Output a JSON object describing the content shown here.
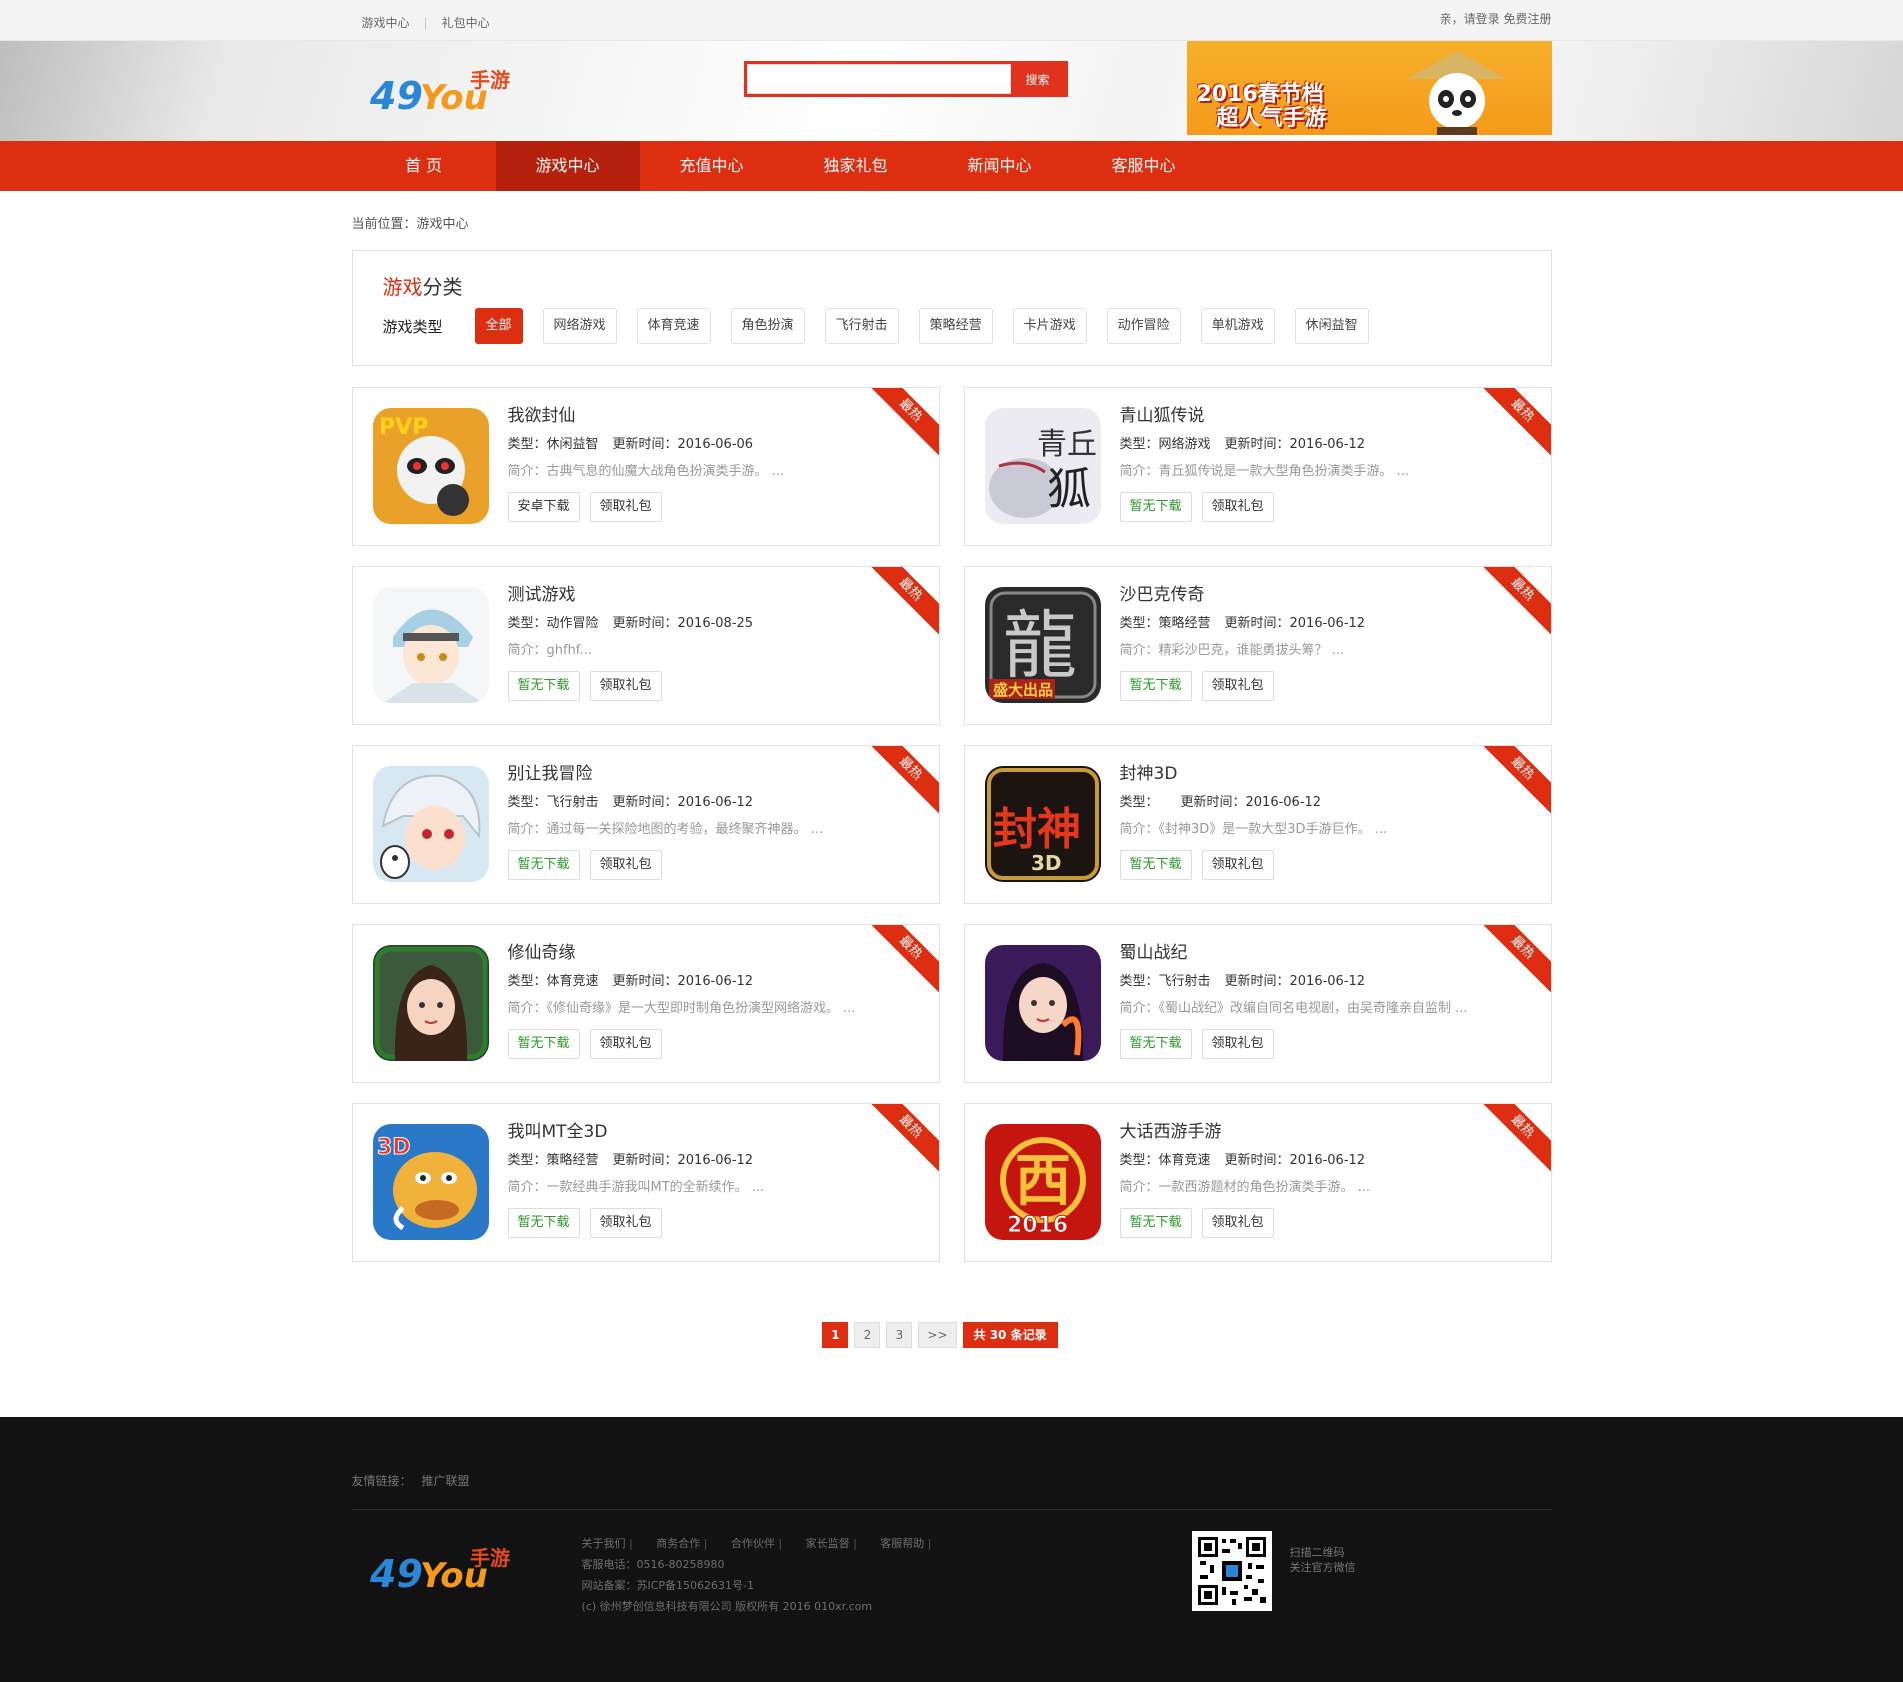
{
  "top": {
    "links": [
      "游戏中心",
      "礼包中心"
    ],
    "greeting": "亲，请登录",
    "register": "免费注册"
  },
  "header": {
    "logo_text": "49You手游",
    "search_button": "搜索",
    "search_value": "",
    "banner_line1": "2016春节档",
    "banner_line2": "超人气手游"
  },
  "nav": [
    "首 页",
    "游戏中心",
    "充值中心",
    "独家礼包",
    "新闻中心",
    "客服中心"
  ],
  "breadcrumb": "当前位置：游戏中心",
  "category": {
    "title_red": "游戏",
    "title_rest": "分类",
    "label": "游戏类型",
    "types": [
      "全部",
      "网络游戏",
      "体育竞速",
      "角色扮演",
      "飞行射击",
      "策略经营",
      "卡片游戏",
      "动作冒险",
      "单机游戏",
      "休闲益智"
    ]
  },
  "games": [
    {
      "name": "我欲封仙",
      "type": "类型：休闲益智",
      "updated": "更新时间：2016-06-06",
      "desc": "简介：古典气息的仙魔大战角色扮演类手游。 ...",
      "download": "安卓下载",
      "gift": "领取礼包",
      "badge": "最热"
    },
    {
      "name": "青山狐传说",
      "type": "类型：网络游戏",
      "updated": "更新时间：2016-06-12",
      "desc": "简介：青丘狐传说是一款大型角色扮演类手游。 ...",
      "download": "暂无下载",
      "gift": "领取礼包",
      "badge": "最热"
    },
    {
      "name": "测试游戏",
      "type": "类型：动作冒险",
      "updated": "更新时间：2016-08-25",
      "desc": "简介：ghfhf...",
      "download": "暂无下载",
      "gift": "领取礼包",
      "badge": "最热"
    },
    {
      "name": "沙巴克传奇",
      "type": "类型：策略经营",
      "updated": "更新时间：2016-06-12",
      "desc": "简介：精彩沙巴克，谁能勇拔头筹？ ...",
      "download": "暂无下载",
      "gift": "领取礼包",
      "badge": "最热"
    },
    {
      "name": "别让我冒险",
      "type": "类型：飞行射击",
      "updated": "更新时间：2016-06-12",
      "desc": "简介：通过每一关探险地图的考验，最终聚齐神器。 ...",
      "download": "暂无下载",
      "gift": "领取礼包",
      "badge": "最热"
    },
    {
      "name": "封神3D",
      "type": "类型：",
      "updated": "更新时间：2016-06-12",
      "desc": "简介：《封神3D》是一款大型3D手游巨作。 ...",
      "download": "暂无下载",
      "gift": "领取礼包",
      "badge": "最热"
    },
    {
      "name": "修仙奇缘",
      "type": "类型：体育竞速",
      "updated": "更新时间：2016-06-12",
      "desc": "简介：《修仙奇缘》是一大型即时制角色扮演型网络游戏。 ...",
      "download": "暂无下载",
      "gift": "领取礼包",
      "badge": "最热"
    },
    {
      "name": "蜀山战纪",
      "type": "类型：飞行射击",
      "updated": "更新时间：2016-06-12",
      "desc": "简介：《蜀山战纪》改编自同名电视剧，由吴奇隆亲自监制 ...",
      "download": "暂无下载",
      "gift": "领取礼包",
      "badge": "最热"
    },
    {
      "name": "我叫MT全3D",
      "type": "类型：策略经营",
      "updated": "更新时间：2016-06-12",
      "desc": "简介：一款经典手游我叫MT的全新续作。 ...",
      "download": "暂无下载",
      "gift": "领取礼包",
      "badge": "最热"
    },
    {
      "name": "大话西游手游",
      "type": "类型：体育竞速",
      "updated": "更新时间：2016-06-12",
      "desc": "简介：一款西游题材的角色扮演类手游。 ...",
      "download": "暂无下载",
      "gift": "领取礼包",
      "badge": "最热"
    }
  ],
  "pager": {
    "pages": [
      "1",
      "2",
      "3"
    ],
    "next": ">>",
    "total": "共 30 条记录",
    "current": "1"
  },
  "footer": {
    "friend_label": "友情链接：",
    "friend_link": "推广联盟",
    "links": [
      "关于我们",
      "商务合作",
      "合作伙伴",
      "家长监督",
      "客服帮助"
    ],
    "phone": "客服电话：0516-80258980",
    "icp": "网站备案：苏ICP备15062631号-1",
    "copyright": "(c) 徐州梦创信息科技有限公司 版权所有 2016 010xr.com",
    "qr_line1": "扫描二维码",
    "qr_line2": "关注官方微信"
  },
  "colors": {
    "accent": "#de2e12",
    "nav_active": "#b5210c",
    "download_green": "#2a9a26",
    "footer_bg": "#121212"
  }
}
